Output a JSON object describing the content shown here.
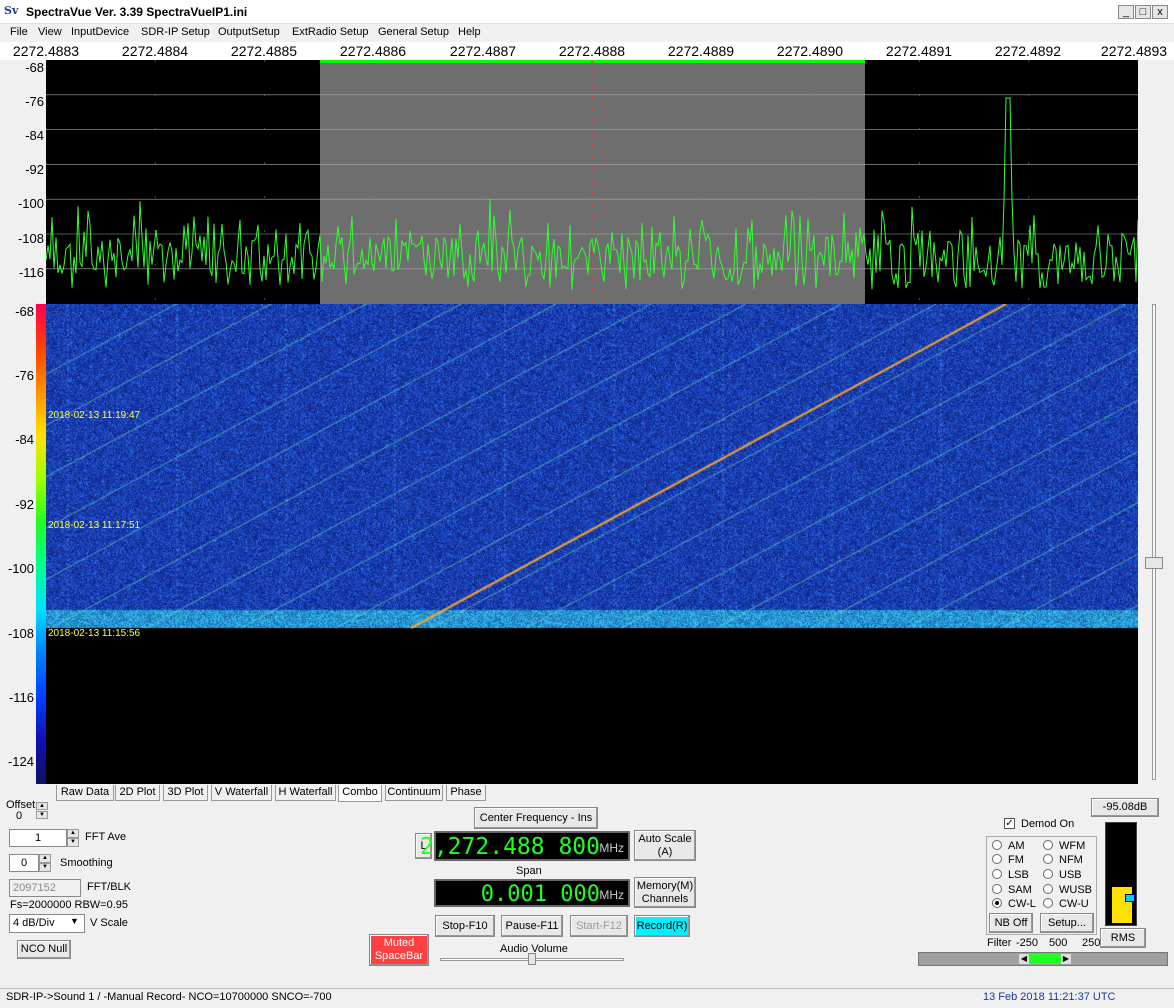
{
  "window": {
    "logo": "Sv",
    "title": "SpectraVue Ver. 3.39  SpectraVueIP1.ini",
    "min_label": "_",
    "max_label": "□",
    "close_label": "x"
  },
  "menu": [
    "File",
    "View",
    "InputDevice",
    "SDR-IP Setup",
    "OutputSetup",
    "ExtRadio Setup",
    "General Setup",
    "Help"
  ],
  "freq_axis": [
    "2272.4883",
    "2272.4884",
    "2272.4885",
    "2272.4886",
    "2272.4887",
    "2272.4888",
    "2272.4889",
    "2272.4890",
    "2272.4891",
    "2272.4892",
    "2272.4893"
  ],
  "spectrum_y_labels": [
    "-68",
    "-76",
    "-84",
    "-92",
    "-100",
    "-108",
    "-116"
  ],
  "waterfall_y_labels": [
    "-68",
    "-76",
    "-84",
    "-92",
    "-100",
    "-108",
    "-116",
    "-124"
  ],
  "waterfall_timestamps": [
    "2018-02-13 11:19:47",
    "2018-02-13 11:17:51",
    "2018-02-13 11:15:56"
  ],
  "tabs": [
    "Raw Data",
    "2D Plot",
    "3D Plot",
    "V Waterfall",
    "H Waterfall",
    "Combo",
    "Continuum",
    "Phase"
  ],
  "active_tab": "Combo",
  "controls": {
    "offset_label": "Offset",
    "offset_value": "0",
    "fft_ave_value": "1",
    "fft_ave_label": "FFT Ave",
    "smoothing_value": "0",
    "smoothing_label": "Smoothing",
    "fft_blk_value": "2097152",
    "fft_blk_label": "FFT/BLK",
    "fs_info": "Fs=2000000 RBW=0.95",
    "vscale_value": "4 dB/Div",
    "vscale_label": "V Scale",
    "nco_null": "NCO Null"
  },
  "center": {
    "center_freq_button": "Center Frequency - Ins",
    "l_button": "L",
    "freq_value": "2,272.488 800",
    "freq_unit": "MHz",
    "auto_scale": "Auto Scale (A)",
    "span_label": "Span",
    "span_value": "0.001 000",
    "span_unit": "MHz",
    "memory": "Memory(M) Channels",
    "stop": "Stop-F10",
    "pause": "Pause-F11",
    "start": "Start-F12",
    "record": "Record(R)",
    "muted": "Muted SpaceBar",
    "audio_volume": "Audio Volume"
  },
  "demod": {
    "level": "-95.08dB",
    "demod_on": "Demod On",
    "modes": [
      "AM",
      "WFM",
      "FM",
      "NFM",
      "LSB",
      "USB",
      "SAM",
      "WUSB",
      "CW-L",
      "CW-U"
    ],
    "selected": "CW-L",
    "nb_off": "NB Off",
    "setup": "Setup...",
    "rms": "RMS",
    "filter_label": "Filter",
    "filter_low": "-250",
    "filter_width": "500",
    "filter_high": "250"
  },
  "status": {
    "left": "SDR-IP->Sound 1  / -Manual Record-   NCO=10700000  SNCO=-700",
    "right": "13 Feb 2018  11:21:37 UTC"
  },
  "colors": {
    "trace": "#30ff30",
    "passband": "#6e6e6e",
    "passband_bar": "#00ff00",
    "waterfall_bg": "#1a3aa8",
    "lcd_text": "#20ff20"
  }
}
